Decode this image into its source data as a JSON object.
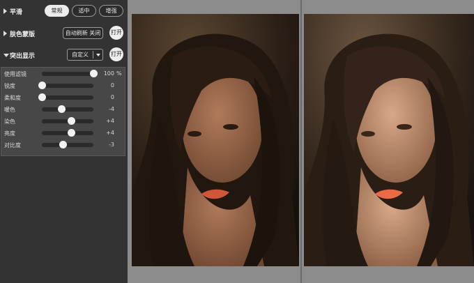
{
  "smooth": {
    "title": "平滑",
    "options": [
      "常规",
      "适中",
      "增强"
    ],
    "selected": "常规"
  },
  "skin_color_mask": {
    "title": "肤色蒙版",
    "auto_refresh_label": "自动刷新 关闭",
    "toggle_label": "打开"
  },
  "highlight": {
    "title": "突出显示",
    "preset_value": "自定义",
    "toggle_label": "打开"
  },
  "sliders": [
    {
      "label": "使用滤镜",
      "value": "100",
      "unit": "%",
      "level": 1.0
    },
    {
      "label": "锐度",
      "value": "0",
      "unit": "",
      "level": 0.0
    },
    {
      "label": "柔和度",
      "value": "0",
      "unit": "",
      "level": 0.0
    },
    {
      "label": "暖色",
      "value": "-4",
      "unit": "",
      "level": 0.38
    },
    {
      "label": "染色",
      "value": "+4",
      "unit": "",
      "level": 0.57
    },
    {
      "label": "亮度",
      "value": "+4",
      "unit": "",
      "level": 0.57
    },
    {
      "label": "对比度",
      "value": "-3",
      "unit": "",
      "level": 0.4
    }
  ],
  "colors": {
    "panel_bg": "#333333",
    "slider_box_bg": "#474747",
    "viewport_bg": "#8c8c8c",
    "button_selected": "#ececec"
  }
}
